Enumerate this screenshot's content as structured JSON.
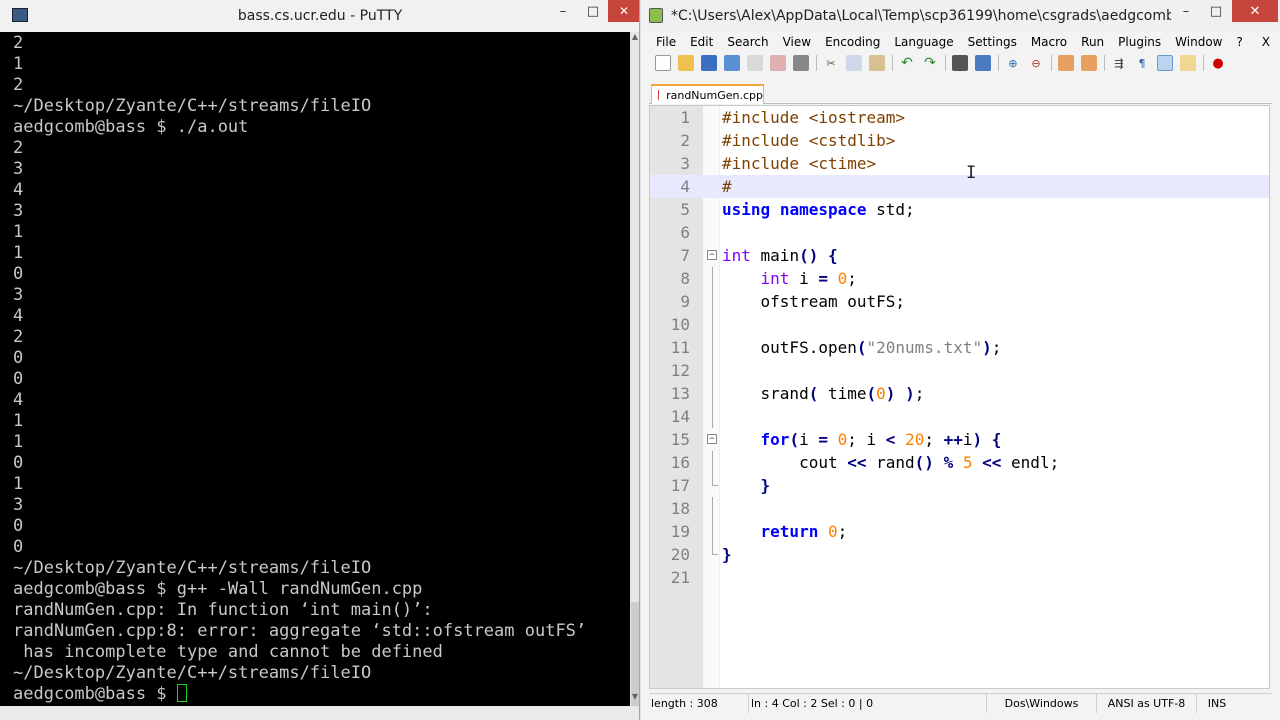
{
  "putty": {
    "title": "bass.cs.ucr.edu - PuTTY",
    "controls": {
      "minimize": "–",
      "maximize": "□",
      "close": "✕"
    },
    "terminal_lines": [
      "2",
      "1",
      "2",
      "~/Desktop/Zyante/C++/streams/fileIO",
      "aedgcomb@bass $ ./a.out",
      "2",
      "3",
      "4",
      "3",
      "1",
      "1",
      "0",
      "3",
      "4",
      "2",
      "0",
      "0",
      "4",
      "1",
      "1",
      "0",
      "1",
      "3",
      "0",
      "0",
      "~/Desktop/Zyante/C++/streams/fileIO",
      "aedgcomb@bass $ g++ -Wall randNumGen.cpp",
      "randNumGen.cpp: In function ‘int main()’:",
      "randNumGen.cpp:8: error: aggregate ‘std::ofstream outFS’",
      " has incomplete type and cannot be defined",
      "~/Desktop/Zyante/C++/streams/fileIO"
    ],
    "prompt_line": "aedgcomb@bass $ "
  },
  "npp": {
    "title": "*C:\\Users\\Alex\\AppData\\Local\\Temp\\scp36199\\home\\csgrads\\aedgcomb\\...",
    "controls": {
      "minimize": "–",
      "maximize": "□",
      "close": "✕"
    },
    "menu": [
      "File",
      "Edit",
      "Search",
      "View",
      "Encoding",
      "Language",
      "Settings",
      "Macro",
      "Run",
      "Plugins",
      "Window",
      "?"
    ],
    "menu_close": "X",
    "tab_label": "randNumGen.cpp",
    "current_line": 4,
    "code_lines": [
      [
        [
          "pp",
          "#include <iostream>"
        ]
      ],
      [
        [
          "pp",
          "#include <cstdlib>"
        ]
      ],
      [
        [
          "pp",
          "#include <ctime>"
        ]
      ],
      [
        [
          "pp",
          "#"
        ]
      ],
      [
        [
          "kw",
          "using"
        ],
        [
          "df",
          " "
        ],
        [
          "kw",
          "namespace"
        ],
        [
          "df",
          " std;"
        ]
      ],
      [],
      [
        [
          "ty",
          "int"
        ],
        [
          "df",
          " main"
        ],
        [
          "op",
          "()"
        ],
        [
          "df",
          " "
        ],
        [
          "op",
          "{"
        ]
      ],
      [
        [
          "df",
          "    "
        ],
        [
          "ty",
          "int"
        ],
        [
          "df",
          " i "
        ],
        [
          "op",
          "="
        ],
        [
          "df",
          " "
        ],
        [
          "nm",
          "0"
        ],
        [
          "df",
          ";"
        ]
      ],
      [
        [
          "df",
          "    ofstream outFS;"
        ]
      ],
      [],
      [
        [
          "df",
          "    outFS.open"
        ],
        [
          "op",
          "("
        ],
        [
          "st",
          "\"20nums.txt\""
        ],
        [
          "op",
          ")"
        ],
        [
          "df",
          ";"
        ]
      ],
      [],
      [
        [
          "df",
          "    srand"
        ],
        [
          "op",
          "("
        ],
        [
          "df",
          " time"
        ],
        [
          "op",
          "("
        ],
        [
          "nm",
          "0"
        ],
        [
          "op",
          ")"
        ],
        [
          "df",
          " "
        ],
        [
          "op",
          ")"
        ],
        [
          "df",
          ";"
        ]
      ],
      [],
      [
        [
          "df",
          "    "
        ],
        [
          "kw",
          "for"
        ],
        [
          "op",
          "("
        ],
        [
          "df",
          "i "
        ],
        [
          "op",
          "="
        ],
        [
          "df",
          " "
        ],
        [
          "nm",
          "0"
        ],
        [
          "df",
          "; i "
        ],
        [
          "op",
          "<"
        ],
        [
          "df",
          " "
        ],
        [
          "nm",
          "20"
        ],
        [
          "df",
          "; "
        ],
        [
          "op",
          "++"
        ],
        [
          "df",
          "i"
        ],
        [
          "op",
          ")"
        ],
        [
          "df",
          " "
        ],
        [
          "op",
          "{"
        ]
      ],
      [
        [
          "df",
          "        cout "
        ],
        [
          "op",
          "<<"
        ],
        [
          "df",
          " rand"
        ],
        [
          "op",
          "()"
        ],
        [
          "df",
          " "
        ],
        [
          "op",
          "%"
        ],
        [
          "df",
          " "
        ],
        [
          "nm",
          "5"
        ],
        [
          "df",
          " "
        ],
        [
          "op",
          "<<"
        ],
        [
          "df",
          " endl;"
        ]
      ],
      [
        [
          "df",
          "    "
        ],
        [
          "op",
          "}"
        ]
      ],
      [],
      [
        [
          "df",
          "    "
        ],
        [
          "kw",
          "return"
        ],
        [
          "df",
          " "
        ],
        [
          "nm",
          "0"
        ],
        [
          "df",
          ";"
        ]
      ],
      [
        [
          "op",
          "}"
        ]
      ],
      []
    ],
    "status": {
      "length": "length : 308",
      "position": "ln : 4    Col : 2    Sel : 0 | 0",
      "eol": "Dos\\Windows",
      "encoding": "ANSI as UTF-8",
      "mode": "INS"
    }
  }
}
